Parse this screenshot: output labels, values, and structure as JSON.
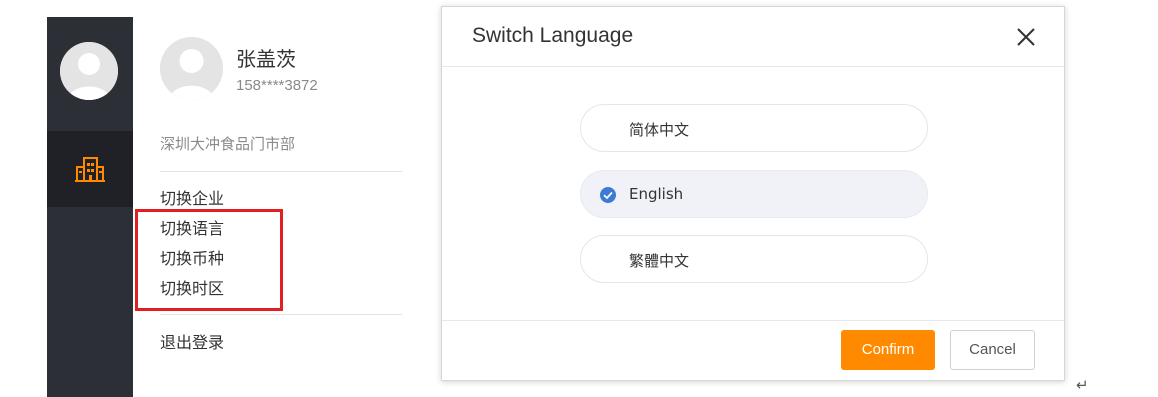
{
  "sidebar": {
    "avatar_icon": "user-avatar-icon",
    "active_nav_icon": "building-icon",
    "accent_color": "#ff8a00"
  },
  "user_panel": {
    "name": "张盖茨",
    "phone": "158****3872",
    "company": "深圳大冲食品门市部",
    "menu": [
      {
        "label": "切换企业"
      },
      {
        "label": "切换语言"
      },
      {
        "label": "切换币种"
      },
      {
        "label": "切换时区"
      }
    ],
    "logout_label": "退出登录",
    "highlight_color": "#e02020"
  },
  "dialog": {
    "title": "Switch Language",
    "close_icon": "close-icon",
    "options": [
      {
        "label": "简体中文",
        "selected": false
      },
      {
        "label": "English",
        "selected": true
      },
      {
        "label": "繁體中文",
        "selected": false
      }
    ],
    "confirm_label": "Confirm",
    "cancel_label": "Cancel",
    "primary_color": "#ff8a00",
    "check_color": "#3a7bd5"
  },
  "return_mark": "↵"
}
